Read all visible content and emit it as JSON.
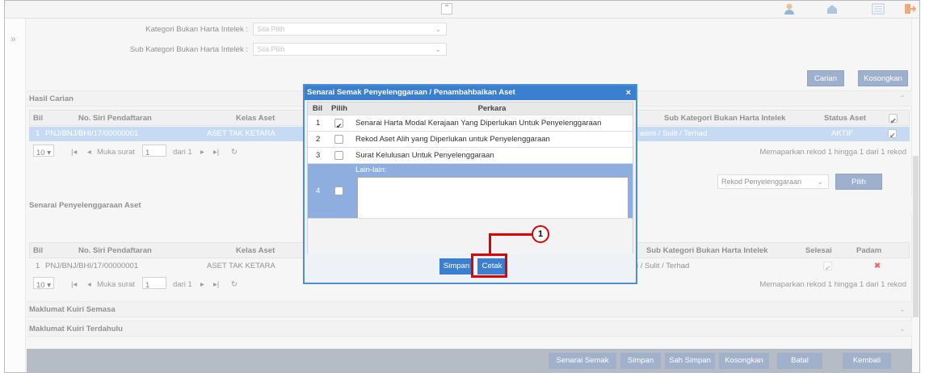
{
  "filters": {
    "kategori_label": "Kategori Bukan Harta Intelek :",
    "kategori_value": "Sila Pilih",
    "subkategori_label": "Sub Kategori Bukan Harta Intelek :",
    "subkategori_value": "Sila Pilih"
  },
  "search_buttons": {
    "carian": "Carian",
    "kosongkan": "Kosongkan"
  },
  "hasil_carian": {
    "title": "Hasil Carian",
    "columns": {
      "bil": "Bil",
      "no_siri": "No. Siri Pendaftaran",
      "kelas": "Kelas Aset",
      "sub_kategori": "Sub Kategori Bukan Harta Intelek",
      "status": "Status Aset"
    },
    "row": {
      "bil": "1",
      "no_siri": "PNJ/BNJ/BHI/17/00000001",
      "kelas": "ASET TAK KETARA",
      "sub_kategori": "asmi / Sulit / Terhad",
      "status": "AKTIF"
    },
    "pager": {
      "size": "10 ▾",
      "muka_surat": "Muka surat",
      "page": "1",
      "dari": "dari 1",
      "info": "Memaparkan rekod 1 hingga 1 dari 1 rekod"
    },
    "dropdown": "Rekod Penyelenggaraan",
    "pilih": "Pilih"
  },
  "senarai": {
    "title": "Senarai Penyelenggaraan Aset",
    "columns": {
      "bil": "Bil",
      "no_siri": "No. Siri Pendaftaran",
      "kelas": "Kelas Aset",
      "sub_kategori": "Sub Kategori Bukan Harta Intelek",
      "selesai": "Selesai",
      "padam": "Padam"
    },
    "row": {
      "bil": "1",
      "no_siri": "PNJ/BNJ/BHI/17/00000001",
      "kelas": "ASET TAK KETARA",
      "sub_kategori": "i / Sulit / Terhad"
    },
    "pager": {
      "size": "10 ▾",
      "muka_surat": "Muka surat",
      "page": "1",
      "dari": "dari 1",
      "info": "Memaparkan rekod 1 hingga 1 dari 1 rekod"
    }
  },
  "sections": {
    "kuiri_semasa": "Maklumat Kuiri Semasa",
    "kuiri_terdahulu": "Maklumat Kuiri Terdahulu"
  },
  "footer": [
    "Senarai Semak",
    "Simpan",
    "Sah Simpan",
    "Kosongkan",
    "Batal",
    "Kembali"
  ],
  "dialog": {
    "title": "Senarai Semak Penyelenggaraan / Penambahbaikan Aset",
    "close": "×",
    "columns": {
      "bil": "Bil",
      "pilih": "Pilih",
      "perkara": "Perkara"
    },
    "rows": [
      {
        "bil": "1",
        "checked": true,
        "text": "Senarai Harta Modal Kerajaan Yang Diperlukan Untuk Penyelenggaraan"
      },
      {
        "bil": "2",
        "checked": false,
        "text": "Rekod Aset Alih yang Diperlukan untuk Penyelenggaraan"
      },
      {
        "bil": "3",
        "checked": false,
        "text": "Surat Kelulusan Untuk Penyelenggaraan"
      },
      {
        "bil": "4",
        "checked": false,
        "text": "Lain-lain:"
      }
    ],
    "simpan": "Simpan",
    "cetak": "Cetak"
  },
  "callout": "1",
  "colors": {
    "accent": "#3b7fd0",
    "highlight": "#e00000",
    "selected_row": "#a9c6ee"
  }
}
